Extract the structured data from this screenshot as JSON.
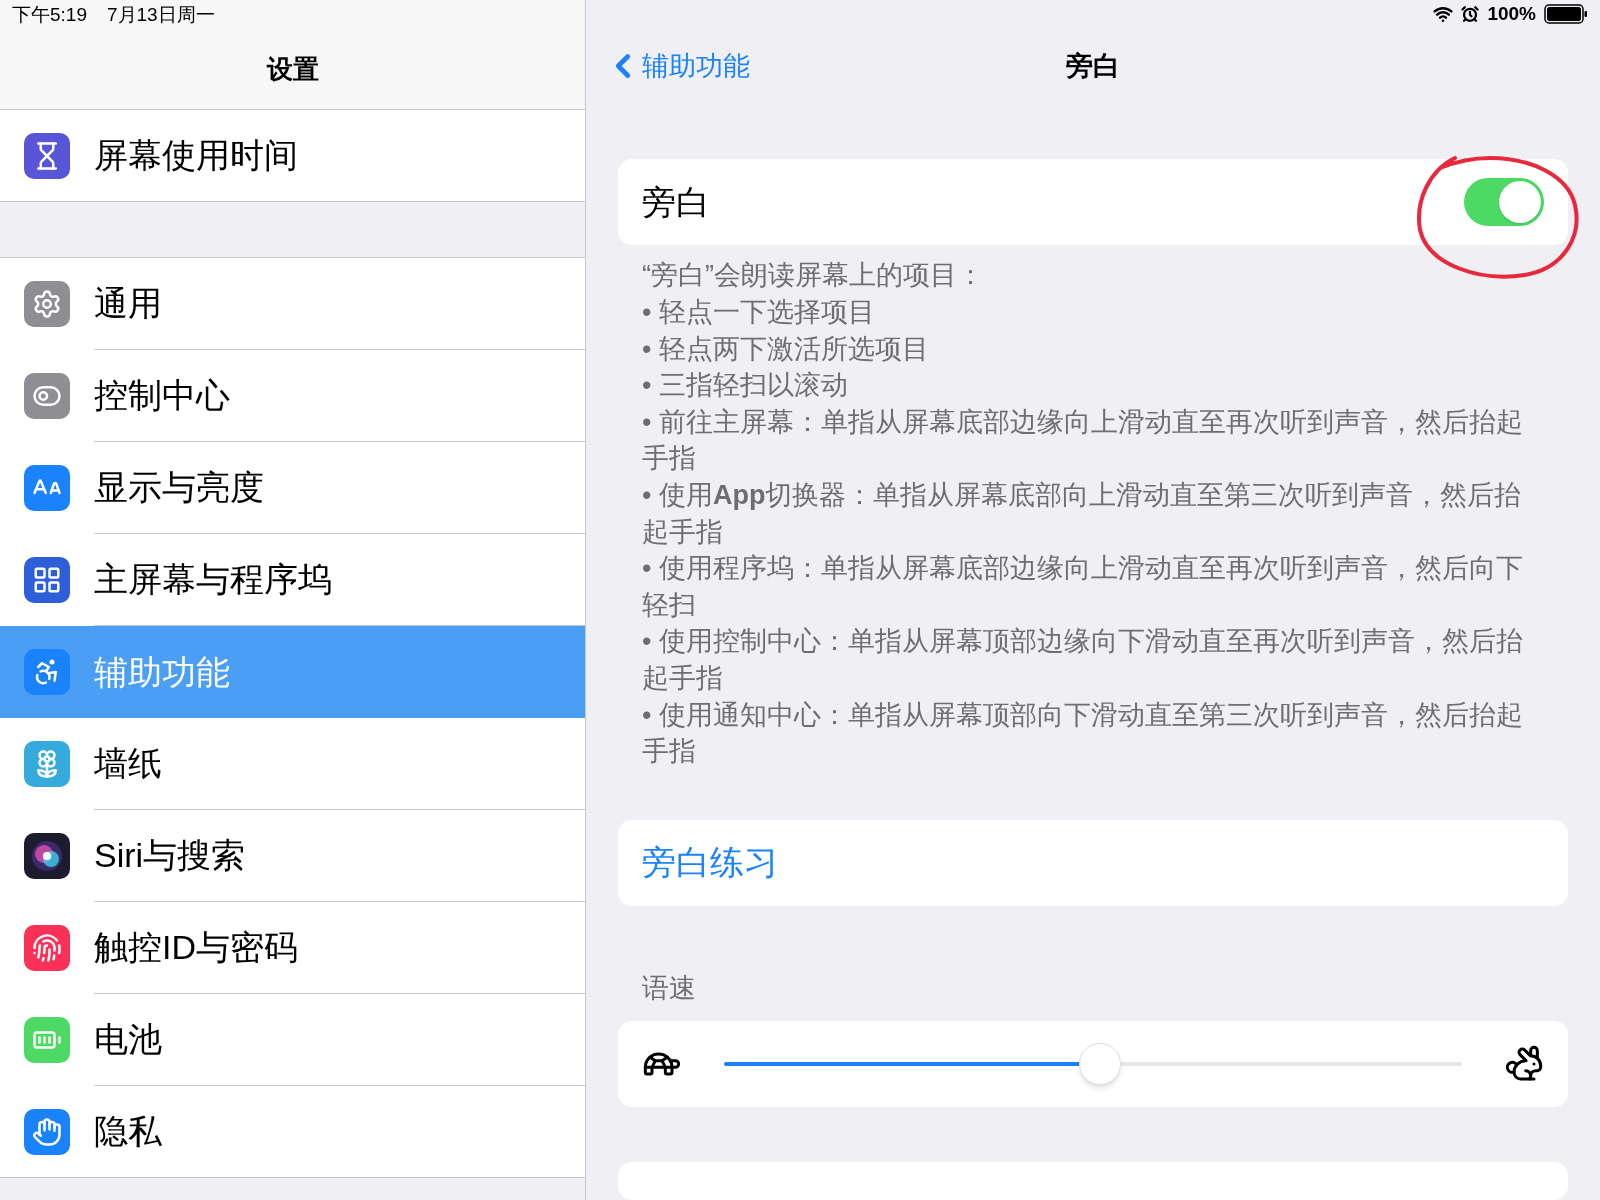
{
  "status_bar": {
    "time": "下午5:19",
    "date": "7月13日周一",
    "battery": "100%"
  },
  "sidebar": {
    "title": "设置",
    "groups": [
      [
        {
          "label": "屏幕使用时间",
          "selected": false
        }
      ],
      [
        {
          "label": "通用",
          "selected": false
        },
        {
          "label": "控制中心",
          "selected": false
        },
        {
          "label": "显示与亮度",
          "selected": false
        },
        {
          "label": "主屏幕与程序坞",
          "selected": false
        },
        {
          "label": "辅助功能",
          "selected": true
        },
        {
          "label": "墙纸",
          "selected": false
        },
        {
          "label": "Siri与搜索",
          "selected": false
        },
        {
          "label": "触控ID与密码",
          "selected": false
        },
        {
          "label": "电池",
          "selected": false
        },
        {
          "label": "隐私",
          "selected": false
        }
      ]
    ]
  },
  "detail": {
    "back": "辅助功能",
    "title": "旁白",
    "voiceover": {
      "label": "旁白",
      "on": true
    },
    "description": [
      "“旁白”会朗读屏幕上的项目：",
      "• 轻点一下选择项目",
      "• 轻点两下激活所选项目",
      "• 三指轻扫以滚动",
      "• 前往主屏幕：单指从屏幕底部边缘向上滑动直至再次听到声音，然后抬起手指",
      "• 使用**App**切换器：单指从屏幕底部向上滑动直至第三次听到声音，然后抬起手指",
      "• 使用程序坞：单指从屏幕底部边缘向上滑动直至再次听到声音，然后向下轻扫",
      "• 使用控制中心：单指从屏幕顶部边缘向下滑动直至再次听到声音，然后抬起手指",
      "• 使用通知中心：单指从屏幕顶部向下滑动直至第三次听到声音，然后抬起手指"
    ],
    "practice": "旁白练习",
    "rate": {
      "label": "语速",
      "level": 0.51
    }
  }
}
